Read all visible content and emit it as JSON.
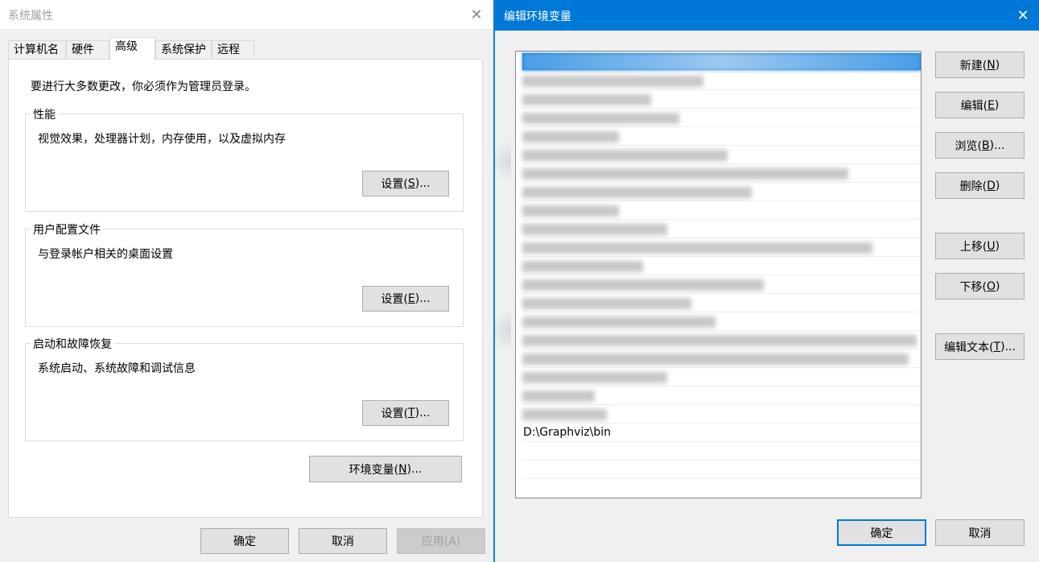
{
  "system_properties": {
    "title": "系统属性",
    "tabs": [
      "计算机名",
      "硬件",
      "高级",
      "系统保护",
      "远程"
    ],
    "active_tab": "高级",
    "admin_note": "要进行大多数更改，你必须作为管理员登录。",
    "performance": {
      "label": "性能",
      "desc": "视觉效果，处理器计划，内存使用，以及虚拟内存",
      "button": "设置(",
      "button_key": "S",
      "button_tail": ")..."
    },
    "user_profiles": {
      "label": "用户配置文件",
      "desc": "与登录帐户相关的桌面设置",
      "button": "设置(",
      "button_key": "E",
      "button_tail": ")..."
    },
    "startup_recovery": {
      "label": "启动和故障恢复",
      "desc": "系统启动、系统故障和调试信息",
      "button": "设置(",
      "button_key": "T",
      "button_tail": ")..."
    },
    "env_vars_button": {
      "text": "环境变量(",
      "key": "N",
      "tail": ")..."
    },
    "ok": "确定",
    "cancel": "取消",
    "apply": "应用(A)"
  },
  "edit_env": {
    "title": "编辑环境变量",
    "visible_entry": "D:\\Graphviz\\bin",
    "blurred_rows": 20,
    "buttons": {
      "new": {
        "text": "新建(",
        "key": "N",
        "tail": ")"
      },
      "edit": {
        "text": "编辑(",
        "key": "E",
        "tail": ")"
      },
      "browse": {
        "text": "浏览(",
        "key": "B",
        "tail": ")..."
      },
      "delete": {
        "text": "删除(",
        "key": "D",
        "tail": ")"
      },
      "move_up": {
        "text": "上移(",
        "key": "U",
        "tail": ")"
      },
      "move_down": {
        "text": "下移(",
        "key": "O",
        "tail": ")"
      },
      "edit_text": {
        "text": "编辑文本(",
        "key": "T",
        "tail": ")..."
      }
    },
    "ok": "确定",
    "cancel": "取消"
  },
  "colors": {
    "accent": "#0078d7",
    "title_bar_active": "#0078d7"
  },
  "icons": {
    "close": "close-icon"
  }
}
